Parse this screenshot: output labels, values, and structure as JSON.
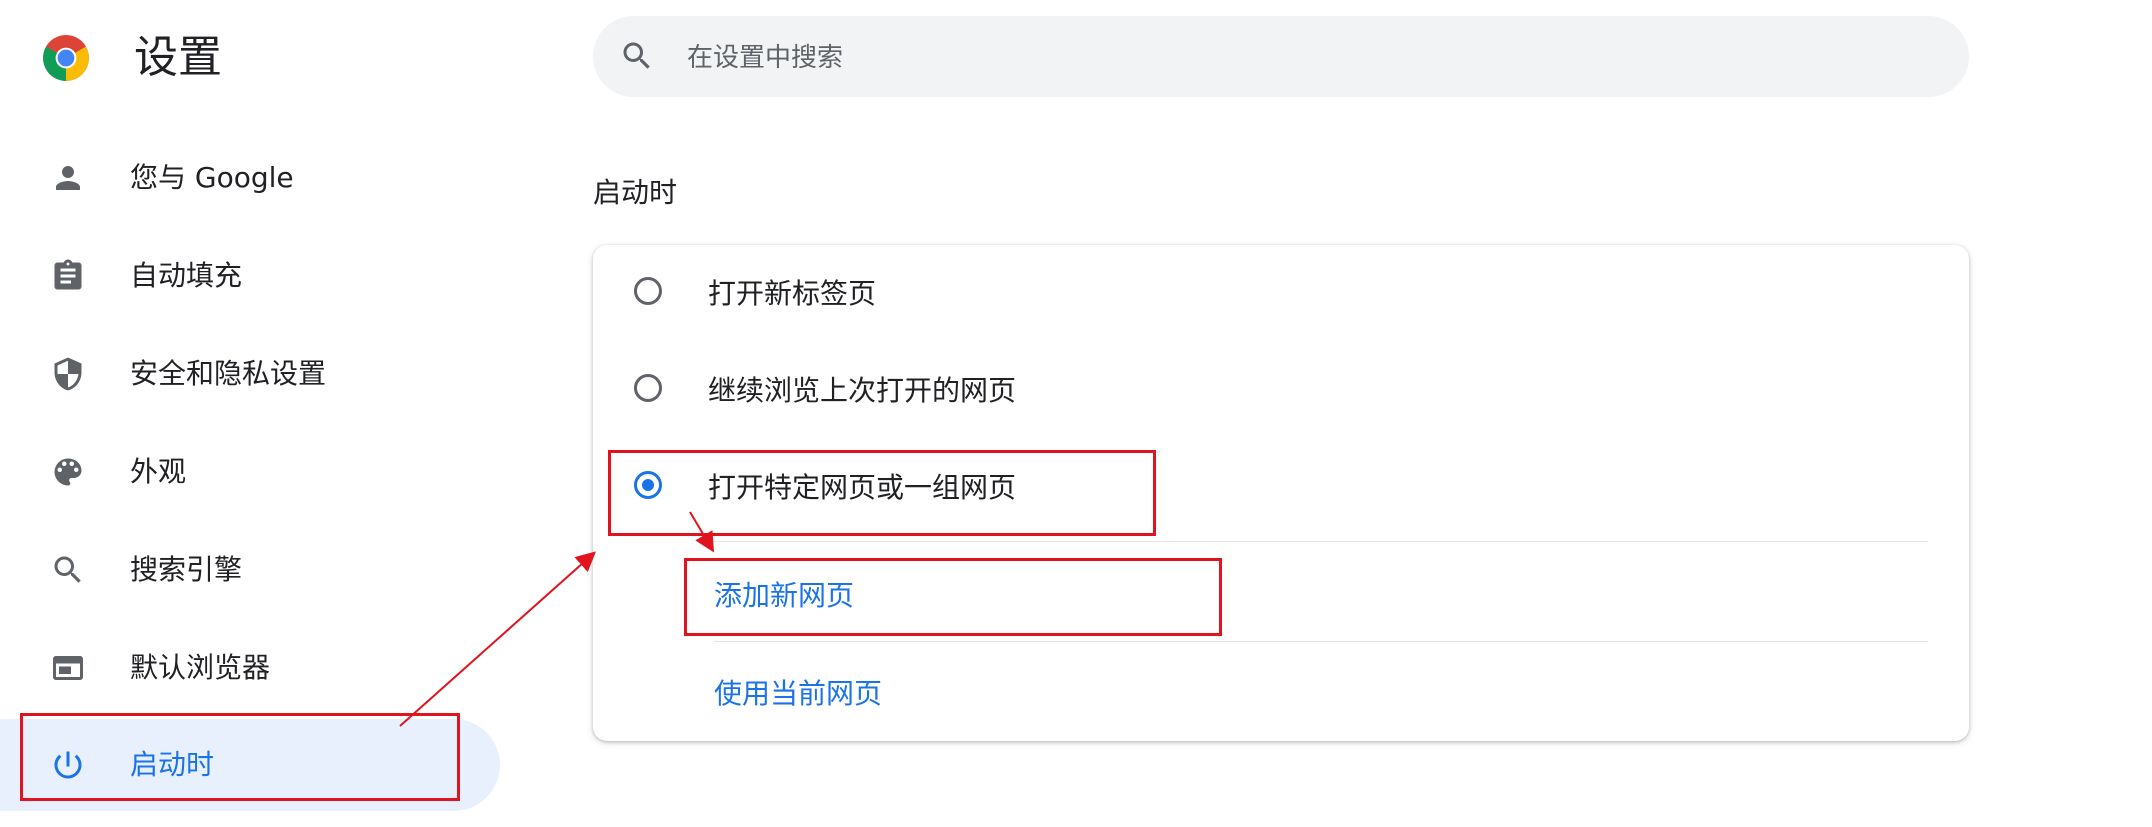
{
  "header": {
    "app_title": "设置",
    "search": {
      "placeholder": "在设置中搜索",
      "value": ""
    }
  },
  "sidebar": {
    "items": [
      {
        "label": "您与 Google",
        "icon": "person-icon"
      },
      {
        "label": "自动填充",
        "icon": "clipboard-icon"
      },
      {
        "label": "安全和隐私设置",
        "icon": "shield-icon"
      },
      {
        "label": "外观",
        "icon": "palette-icon"
      },
      {
        "label": "搜索引擎",
        "icon": "search-icon"
      },
      {
        "label": "默认浏览器",
        "icon": "browser-window-icon"
      },
      {
        "label": "启动时",
        "icon": "power-icon",
        "active": true
      }
    ]
  },
  "main": {
    "section_title": "启动时",
    "options": [
      {
        "label": "打开新标签页",
        "checked": false
      },
      {
        "label": "继续浏览上次打开的网页",
        "checked": false
      },
      {
        "label": "打开特定网页或一组网页",
        "checked": true
      }
    ],
    "links": {
      "add_page": "添加新网页",
      "use_current": "使用当前网页"
    }
  },
  "colors": {
    "accent": "#1a73e8",
    "active_nav_bg": "#e8f0fe",
    "annotation": "#e0141e",
    "search_bg": "#f1f3f4"
  }
}
